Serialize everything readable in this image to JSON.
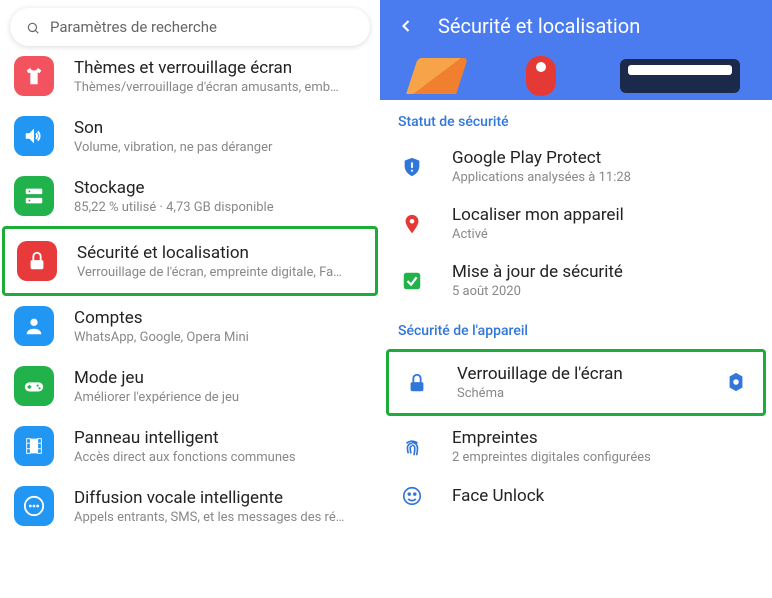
{
  "left": {
    "search_placeholder": "Paramètres de recherche",
    "items": [
      {
        "title": "Thèmes et verrouillage écran",
        "sub": "Thèmes/verrouillage d'écran amusants, emb…",
        "icon": "shirt-icon",
        "bg": "#f2535f"
      },
      {
        "title": "Son",
        "sub": "Volume, vibration, ne pas déranger",
        "icon": "speaker-icon",
        "bg": "#2196f3"
      },
      {
        "title": "Stockage",
        "sub": "85,22 % utilisé · 4,73 GB disponible",
        "icon": "storage-icon",
        "bg": "#21b24b"
      },
      {
        "title": "Sécurité et localisation",
        "sub": "Verrouillage de l'écran, empreinte digitale, Fa…",
        "icon": "lock-icon",
        "bg": "#e83a3a",
        "highlight": true
      },
      {
        "title": "Comptes",
        "sub": "WhatsApp, Google, Opera Mini",
        "icon": "person-icon",
        "bg": "#2196f3"
      },
      {
        "title": "Mode jeu",
        "sub": "Améliorer l'expérience de jeu",
        "icon": "game-icon",
        "bg": "#21b24b"
      },
      {
        "title": "Panneau intelligent",
        "sub": "Accès direct aux fonctions communes",
        "icon": "film-icon",
        "bg": "#2196f3"
      },
      {
        "title": "Diffusion vocale intelligente",
        "sub": "Appels entrants, SMS, et les messages des ré…",
        "icon": "dots-icon",
        "bg": "#2196f3"
      }
    ]
  },
  "right": {
    "header_title": "Sécurité et localisation",
    "section1": "Statut de sécurité",
    "section2": "Sécurité de l'appareil",
    "items1": [
      {
        "title": "Google Play Protect",
        "sub": "Applications analysées à 11:28",
        "icon": "shield-alert-icon",
        "color": "#3176d9"
      },
      {
        "title": "Localiser mon appareil",
        "sub": "Activé",
        "icon": "map-pin-icon",
        "color": "#e53935"
      },
      {
        "title": "Mise à jour de sécurité",
        "sub": "5 août 2020",
        "icon": "check-icon",
        "color": "#21b24b"
      }
    ],
    "items2": [
      {
        "title": "Verrouillage de l'écran",
        "sub": "Schéma",
        "icon": "lock-icon",
        "color": "#3176d9",
        "highlight": true,
        "gear": true
      },
      {
        "title": "Empreintes",
        "sub": "2 empreintes digitales configurées",
        "icon": "fingerprint-icon",
        "color": "#3176d9"
      },
      {
        "title": "Face Unlock",
        "sub": "",
        "icon": "face-icon",
        "color": "#3176d9"
      }
    ]
  }
}
